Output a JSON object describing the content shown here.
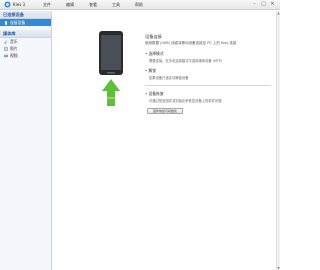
{
  "app": {
    "title": "Kies 3"
  },
  "menu": [
    "文件",
    "编辑",
    "查看",
    "工具",
    "帮助"
  ],
  "window_controls": {
    "minimize": "–",
    "maximize": "□",
    "close": "✕"
  },
  "sidebar": {
    "connected_header": "已连接设备",
    "connected_items": [
      {
        "label": "连接设备",
        "icon": "phone-icon"
      }
    ],
    "library_header": "媒体库",
    "library_items": [
      {
        "label": "音乐",
        "icon": "music-icon"
      },
      {
        "label": "照片",
        "icon": "photo-icon"
      },
      {
        "label": "视频",
        "icon": "video-icon"
      }
    ]
  },
  "main": {
    "title": "设备连接",
    "desc": "使用数据 (USB) 线缆将移动设备连接至 PC 上的 Kies 连接",
    "bullets": [
      {
        "title": "• 选择模式",
        "line": "需要连接。在手机连接模式中选择媒体设备 (MTP)"
      },
      {
        "title": "• 解锁",
        "line": "如果设备已锁定请解锁设备"
      }
    ],
    "tip_title": "• 设备恢复",
    "tip_line": "可通过恢复固件或初始化来恢复设备上的软件问题",
    "button_label": "固件恢复与初始化"
  },
  "colors": {
    "accent": "#2f8ad8",
    "arrow": "#5fbf3a",
    "header_text": "#2c5a9a"
  }
}
